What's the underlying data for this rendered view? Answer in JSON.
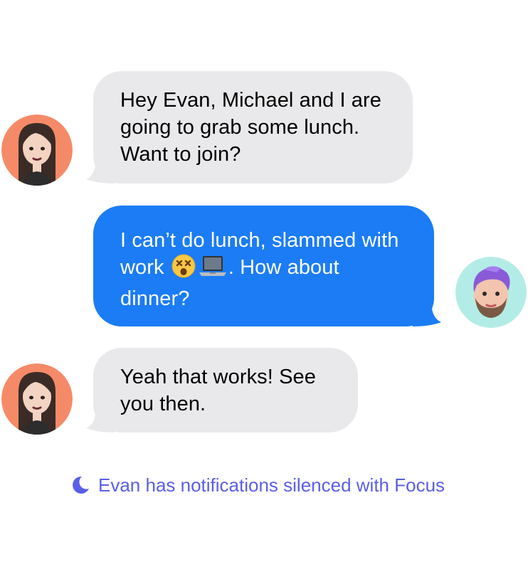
{
  "messages": [
    {
      "direction": "incoming",
      "sender_avatar": "woman-memoji-avatar",
      "text": "Hey Evan, Michael and I are going to grab some lunch. Want to join?"
    },
    {
      "direction": "outgoing",
      "sender_avatar": "man-memoji-avatar",
      "text_before": "I can’t do lunch, slammed with work",
      "emojis": [
        "dizzy-face-emoji",
        "laptop-emoji"
      ],
      "text_after": ". How about dinner?"
    },
    {
      "direction": "incoming",
      "sender_avatar": "woman-memoji-avatar",
      "text": "Yeah that works! See you then."
    }
  ],
  "focus_status": {
    "icon": "moon-icon",
    "text": "Evan has notifications silenced with Focus"
  },
  "colors": {
    "incoming_bubble": "#e9e9eb",
    "outgoing_bubble": "#1b7cf5",
    "focus_text": "#5a5ee8",
    "woman_avatar_bg": "#f58a68",
    "man_avatar_bg": "#b3ece6"
  }
}
